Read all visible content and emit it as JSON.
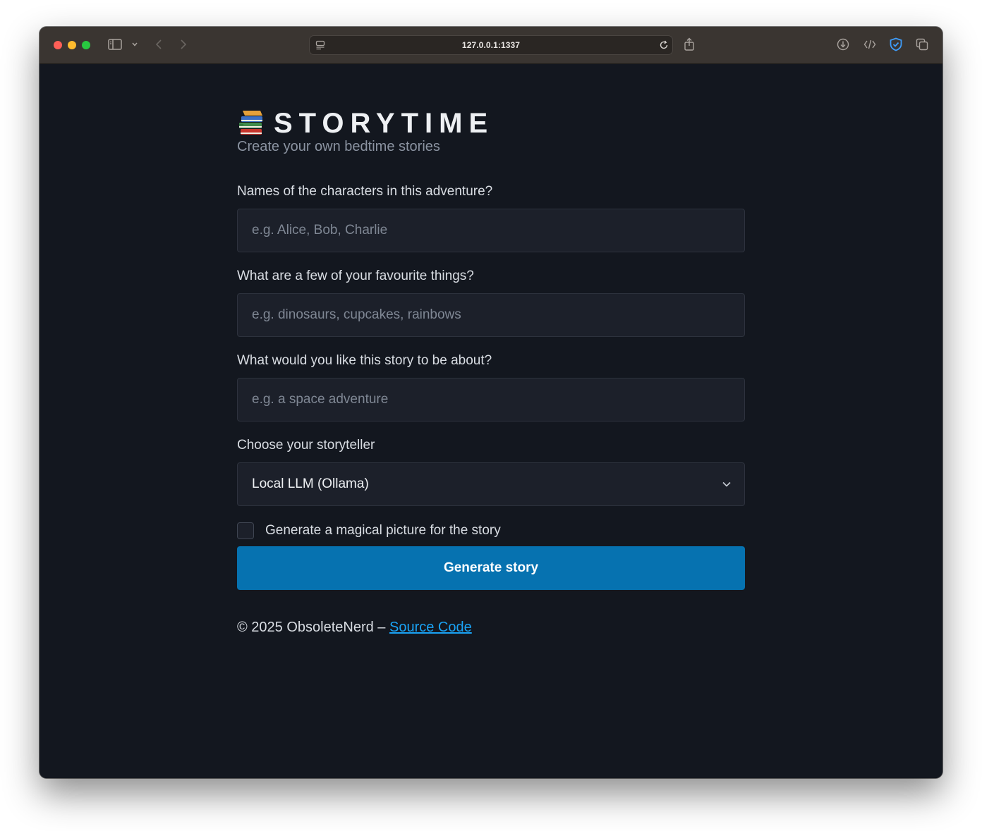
{
  "browser": {
    "url": "127.0.0.1:1337"
  },
  "header": {
    "icon": "books-icon",
    "title": "STORYTIME",
    "subtitle": "Create your own bedtime stories"
  },
  "form": {
    "characters": {
      "label": "Names of the characters in this adventure?",
      "value": "",
      "placeholder": "e.g. Alice, Bob, Charlie"
    },
    "favourites": {
      "label": "What are a few of your favourite things?",
      "value": "",
      "placeholder": "e.g. dinosaurs, cupcakes, rainbows"
    },
    "topic": {
      "label": "What would you like this story to be about?",
      "value": "",
      "placeholder": "e.g. a space adventure"
    },
    "storyteller": {
      "label": "Choose your storyteller",
      "selected": "Local LLM (Ollama)"
    },
    "picture": {
      "label": "Generate a magical picture for the story",
      "checked": false
    },
    "submit_label": "Generate story"
  },
  "footer": {
    "copyright": "© 2025 ObsoleteNerd – ",
    "link_label": "Source Code"
  },
  "colors": {
    "background": "#13171f",
    "input_background": "#1c202a",
    "button": "#0672b0",
    "link": "#1aa3f5"
  }
}
